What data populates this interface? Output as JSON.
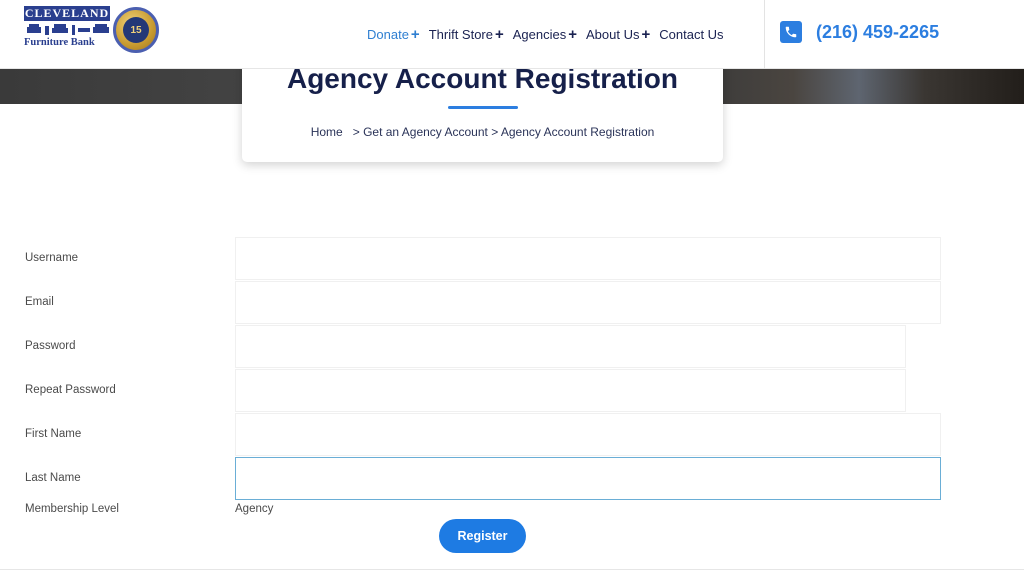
{
  "header": {
    "logo_line1": "CLEVELAND",
    "logo_line2": "Furniture Bank",
    "badge_number": "15",
    "phone": "(216) 459-2265",
    "nav": [
      {
        "label": "Donate",
        "active": true
      },
      {
        "label": "Thrift Store",
        "active": false
      },
      {
        "label": "Agencies",
        "active": false
      },
      {
        "label": "About Us",
        "active": false
      },
      {
        "label": "Contact Us",
        "active": false
      }
    ],
    "nav_plus": "+"
  },
  "page": {
    "title": "Agency Account Registration",
    "breadcrumb": {
      "home": "Home",
      "sep1": ">",
      "parent": "Get an Agency Account",
      "sep2": ">",
      "current": "Agency Account Registration"
    }
  },
  "form": {
    "fields": [
      {
        "label": "Username",
        "value": ""
      },
      {
        "label": "Email",
        "value": ""
      },
      {
        "label": "Password",
        "value": ""
      },
      {
        "label": "Repeat Password",
        "value": ""
      },
      {
        "label": "First Name",
        "value": ""
      },
      {
        "label": "Last Name",
        "value": ""
      }
    ],
    "membership_label": "Membership Level",
    "membership_value": "Agency",
    "submit_label": "Register"
  },
  "colors": {
    "accent": "#2c7ee0",
    "navy": "#16204a",
    "button": "#1e7be3"
  },
  "icons": {
    "phone": "phone-icon"
  }
}
